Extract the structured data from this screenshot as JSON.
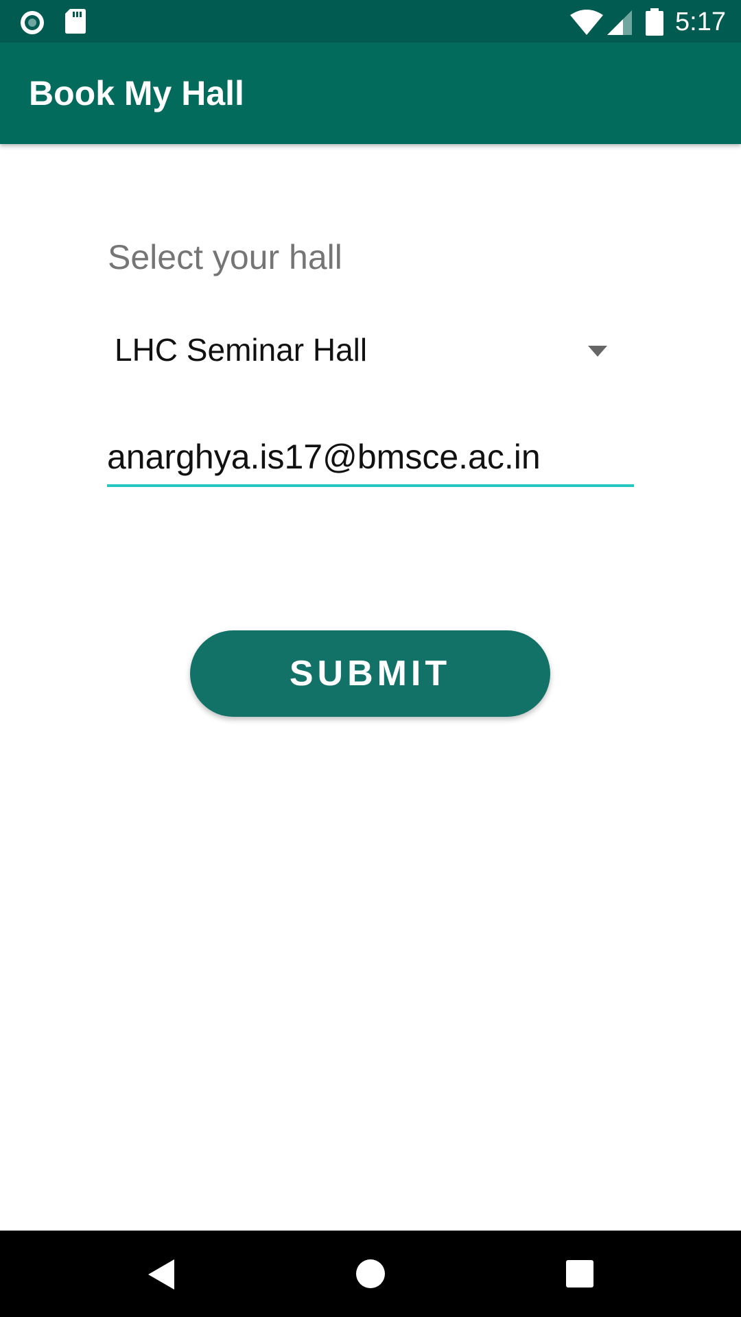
{
  "status_bar": {
    "time": "5:17",
    "icons": [
      "record-icon",
      "sd-card-icon",
      "wifi-icon",
      "signal-icon",
      "battery-icon"
    ]
  },
  "toolbar": {
    "title": "Book My Hall"
  },
  "form": {
    "hall_label": "Select your hall",
    "hall_selected": "LHC Seminar Hall",
    "email_value": "anarghya.is17@bmsce.ac.in",
    "submit_label": "SUBMIT"
  },
  "nav_bar": {
    "icons": [
      "back-icon",
      "home-icon",
      "recents-icon"
    ]
  },
  "colors": {
    "status_bar": "#025b51",
    "toolbar": "#026b5c",
    "button": "#127268",
    "input_underline": "#26c6c1"
  }
}
